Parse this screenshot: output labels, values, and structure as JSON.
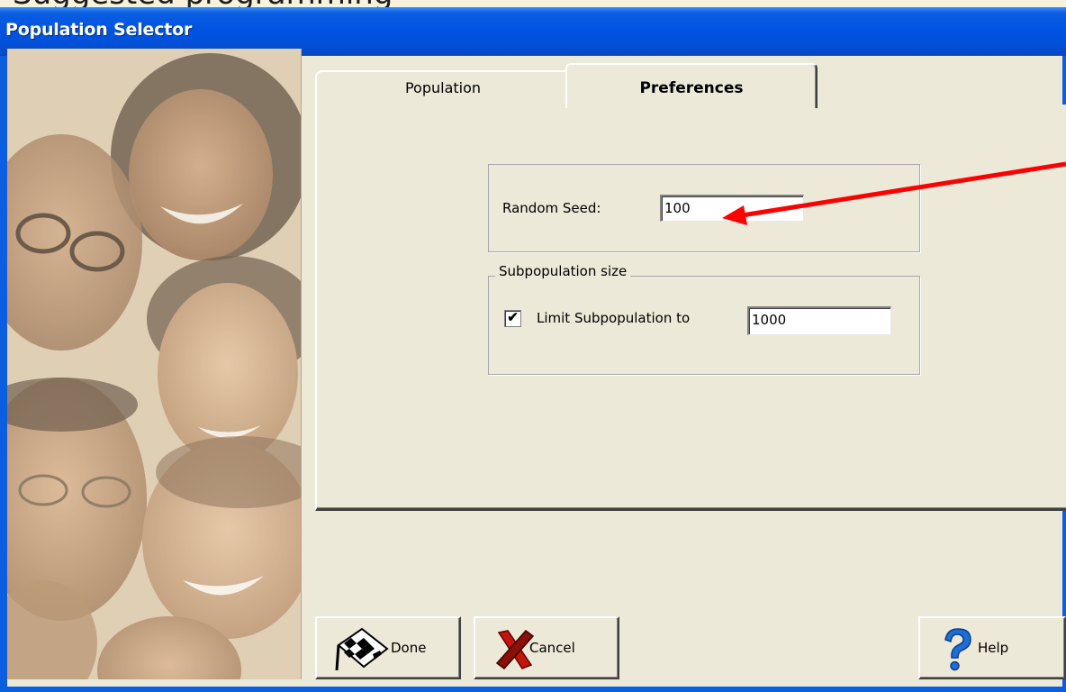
{
  "slide": {
    "partial_title": "Suggested programming"
  },
  "window": {
    "title": "Population Selector"
  },
  "tabs": [
    {
      "label": "Population",
      "active": false
    },
    {
      "label": "Preferences",
      "active": true
    }
  ],
  "preferences": {
    "random_seed_label": "Random Seed:",
    "random_seed_value": "100",
    "subpopulation_group_label": "Subpopulation size",
    "limit_checkbox_label": "Limit Subpopulation to",
    "limit_checked": true,
    "limit_value": "1000"
  },
  "buttons": {
    "done": "Done",
    "cancel": "Cancel",
    "help": "Help"
  },
  "colors": {
    "titlebar": "#0054e3",
    "dialog_bg": "#ece9d8",
    "annotation_arrow": "#ff0000"
  },
  "icons": {
    "done": "checkered-flag-icon",
    "cancel": "red-x-icon",
    "help": "question-mark-icon"
  }
}
